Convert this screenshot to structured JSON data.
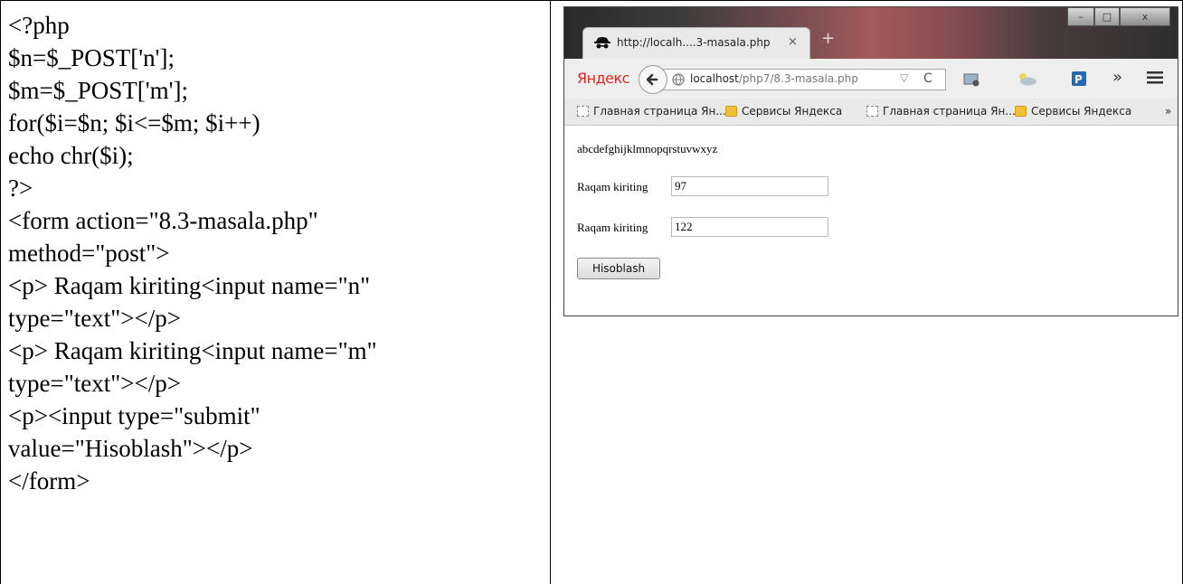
{
  "code_lines": [
    "<?php",
    "$n=$_POST['n'];",
    "$m=$_POST['m'];",
    "for($i=$n; $i<=$m; $i++)",
    "echo chr($i);",
    "?>",
    "<form action=\"8.3-masala.php\"",
    "method=\"post\">",
    "<p> Raqam kiriting<input name=\"n\"",
    "type=\"text\"></p>",
    "<p> Raqam kiriting<input name=\"m\"",
    "type=\"text\"></p>",
    "<p><input type=\"submit\"",
    "value=\"Hisoblash\"></p>",
    "</form>"
  ],
  "browser": {
    "tab_title": "http://localh....3-masala.php",
    "tab_close": "×",
    "new_tab": "+",
    "window_controls": {
      "minimize": "–",
      "maximize": "□",
      "close": "x"
    },
    "brand": "Яндекс",
    "url_host": "localhost",
    "url_path": "/php7/8.3-masala.php",
    "url_dropdown": "▽",
    "url_reload": "C",
    "overflow": "»",
    "bookmarks": [
      {
        "label": "Главная страница Ян...",
        "icon": "page-icon"
      },
      {
        "label": "Сервисы Яндекса",
        "icon": "folder-icon"
      },
      {
        "label": "Главная страница Ян...",
        "icon": "page-icon"
      },
      {
        "label": "Сервисы Яндекса",
        "icon": "folder-icon"
      }
    ],
    "bookmarks_overflow": "»",
    "page": {
      "output": "abcdefghijklmnopqrstuvwxyz",
      "field1_label": "Raqam kiriting",
      "field1_value": "97",
      "field2_label": "Raqam kiriting",
      "field2_value": "122",
      "submit_label": "Hisoblash"
    }
  }
}
